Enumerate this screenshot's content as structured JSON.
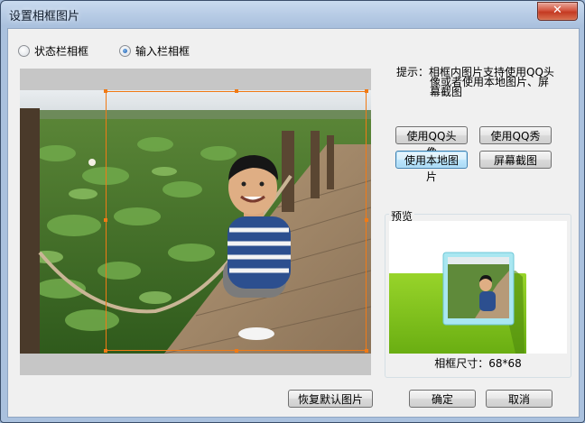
{
  "window": {
    "title": "设置相框图片",
    "close_glyph": "✕"
  },
  "frame_type": {
    "options": [
      {
        "label": "状态栏相框",
        "selected": false
      },
      {
        "label": "输入栏相框",
        "selected": true
      }
    ]
  },
  "hint": {
    "line1": "提示：相框内图片支持使用QQ头",
    "line2": "像或者使用本地图片、屏",
    "line3": "幕截图"
  },
  "source_buttons": {
    "qq_avatar": "使用QQ头像",
    "qq_show": "使用QQ秀",
    "local_image": "使用本地图片",
    "screenshot": "屏幕截图"
  },
  "preview": {
    "label": "预览",
    "size_text": "相框尺寸：68*68"
  },
  "footer": {
    "restore_default": "恢复默认图片",
    "ok": "确定",
    "cancel": "取消"
  },
  "colors": {
    "crop_border": "#f07a15",
    "frame_green": "#7fc21a",
    "focus_blue": "#3c7fb1"
  },
  "icons": {
    "close": "close-icon"
  }
}
